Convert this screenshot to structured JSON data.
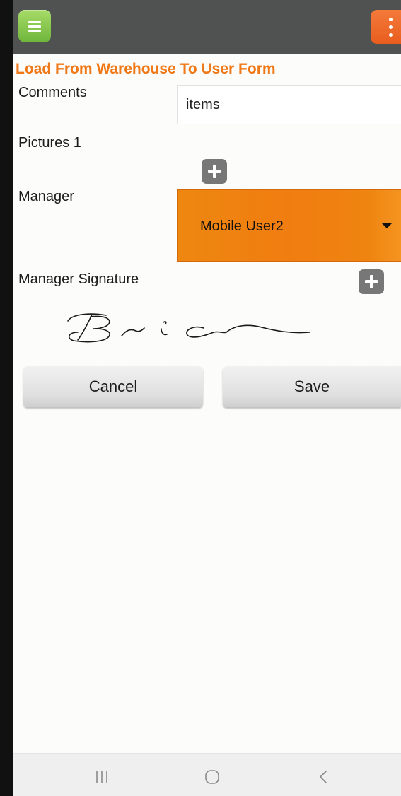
{
  "form": {
    "title": "Load From Warehouse To User Form",
    "comments_label": "Comments",
    "comments_value": "items",
    "pictures_label": "Pictures 1",
    "manager_label": "Manager",
    "manager_value": "Mobile User2",
    "signature_label": "Manager Signature",
    "signature_text": "Brian"
  },
  "buttons": {
    "cancel_label": "Cancel",
    "save_label": "Save"
  },
  "icons": {
    "menu": "hamburger-menu-icon",
    "more": "more-vertical-icon",
    "add": "plus-icon",
    "dropdown": "caret-down-icon",
    "nav_recents": "recent-apps-icon",
    "nav_home": "home-icon",
    "nav_back": "back-icon"
  },
  "colors": {
    "topbar": "#505151",
    "menu_button": "#8cc94f",
    "more_button": "#ee6a2a",
    "title": "#f07816",
    "manager_select": "#f08612"
  }
}
